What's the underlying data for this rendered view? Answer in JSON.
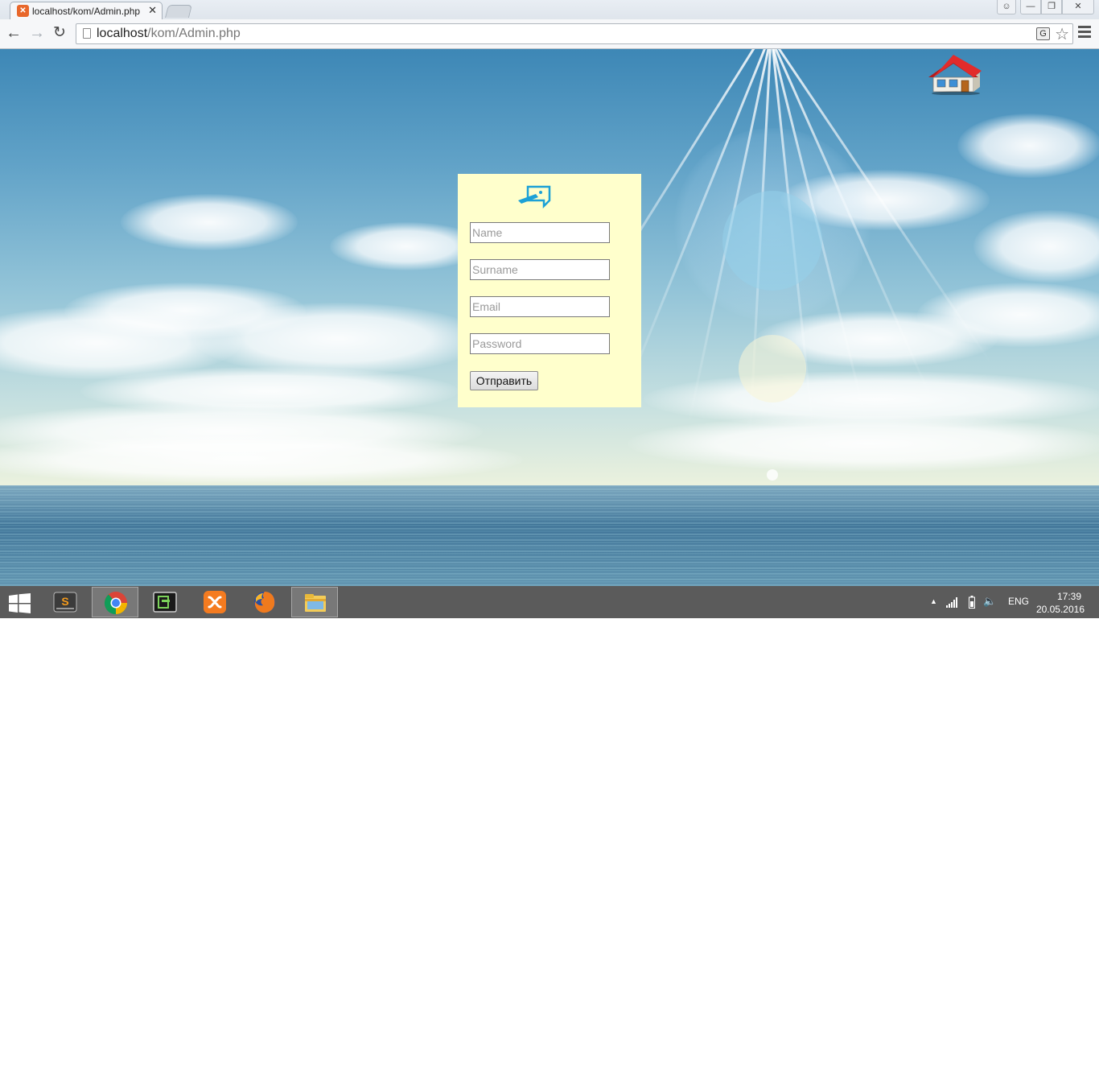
{
  "browser": {
    "tab": {
      "title": "localhost/kom/Admin.php",
      "favicon": "xampp-icon"
    },
    "url": {
      "host": "localhost",
      "path": "/kom/Admin.php"
    }
  },
  "page": {
    "home_icon": "house-icon",
    "form": {
      "logo": "login-logo-icon",
      "name_placeholder": "Name",
      "surname_placeholder": "Surname",
      "email_placeholder": "Email",
      "password_placeholder": "Password",
      "submit_label": "Отправить"
    },
    "colors": {
      "panel_bg": "#ffffcc",
      "logo_accent": "#1da1d6"
    }
  },
  "taskbar": {
    "apps": [
      "sublime-text-icon",
      "chrome-icon",
      "terminal-icon",
      "xampp-icon",
      "firefox-icon",
      "file-explorer-icon"
    ],
    "tray": {
      "language": "ENG",
      "time": "17:39",
      "date": "20.05.2016"
    }
  }
}
